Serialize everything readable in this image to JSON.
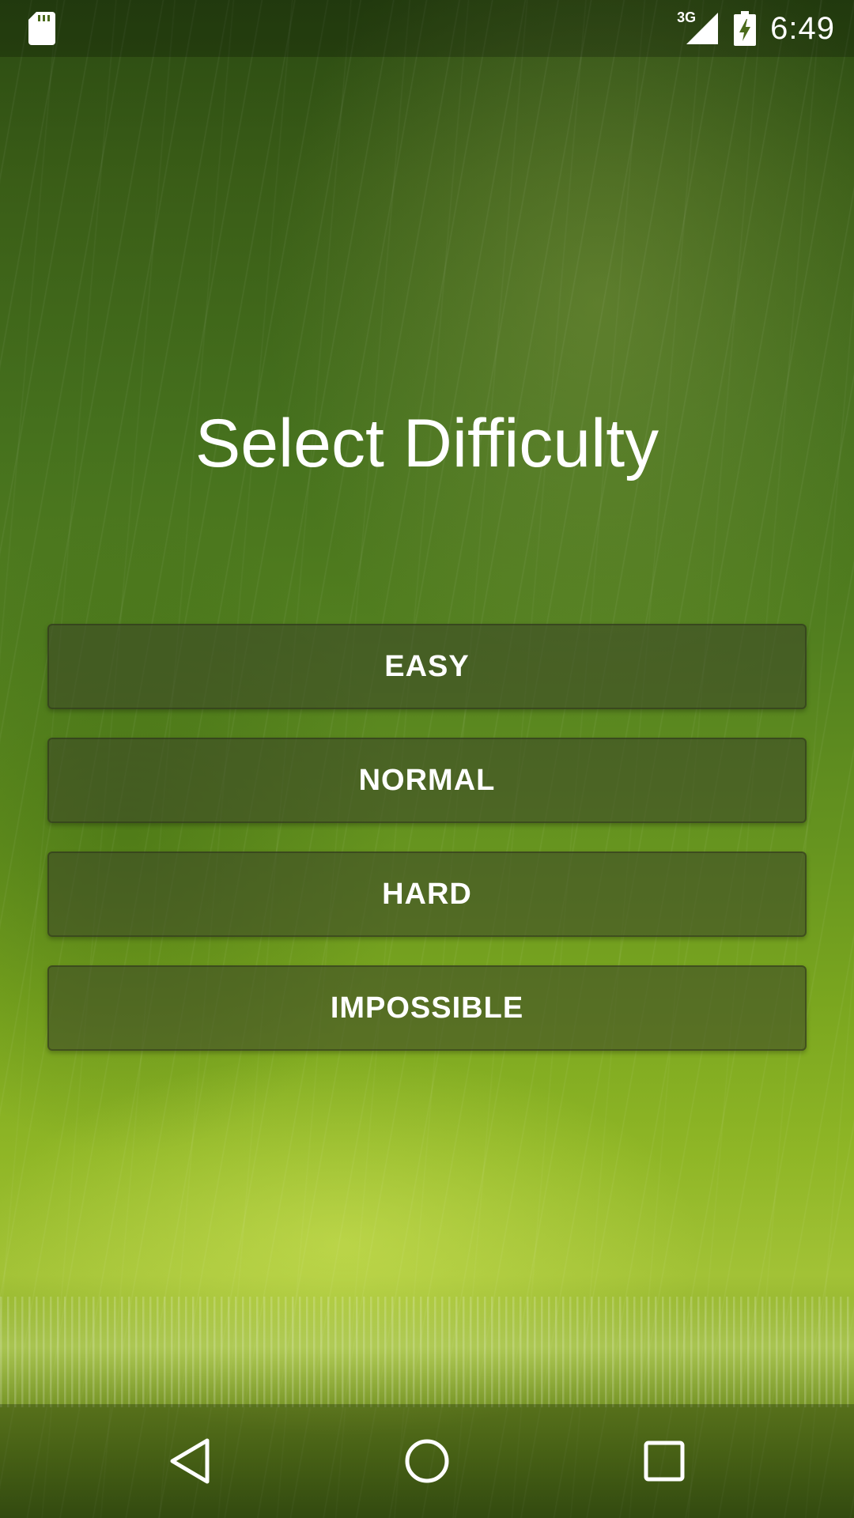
{
  "status_bar": {
    "left_icon": "sd-card-icon",
    "network_type": "3G",
    "signal_icon": "cell-signal-icon",
    "battery_icon": "battery-charging-icon",
    "time": "6:49"
  },
  "screen": {
    "title": "Select Difficulty",
    "buttons": [
      {
        "label": "EASY"
      },
      {
        "label": "NORMAL"
      },
      {
        "label": "HARD"
      },
      {
        "label": "IMPOSSIBLE"
      }
    ]
  },
  "nav_bar": {
    "back_icon": "back-triangle-icon",
    "home_icon": "home-circle-icon",
    "recents_icon": "recents-square-icon"
  },
  "colors": {
    "text": "#ffffff",
    "button_fill": "#3c4628",
    "background_top": "#2b4a12",
    "background_bottom": "#a2c236"
  }
}
